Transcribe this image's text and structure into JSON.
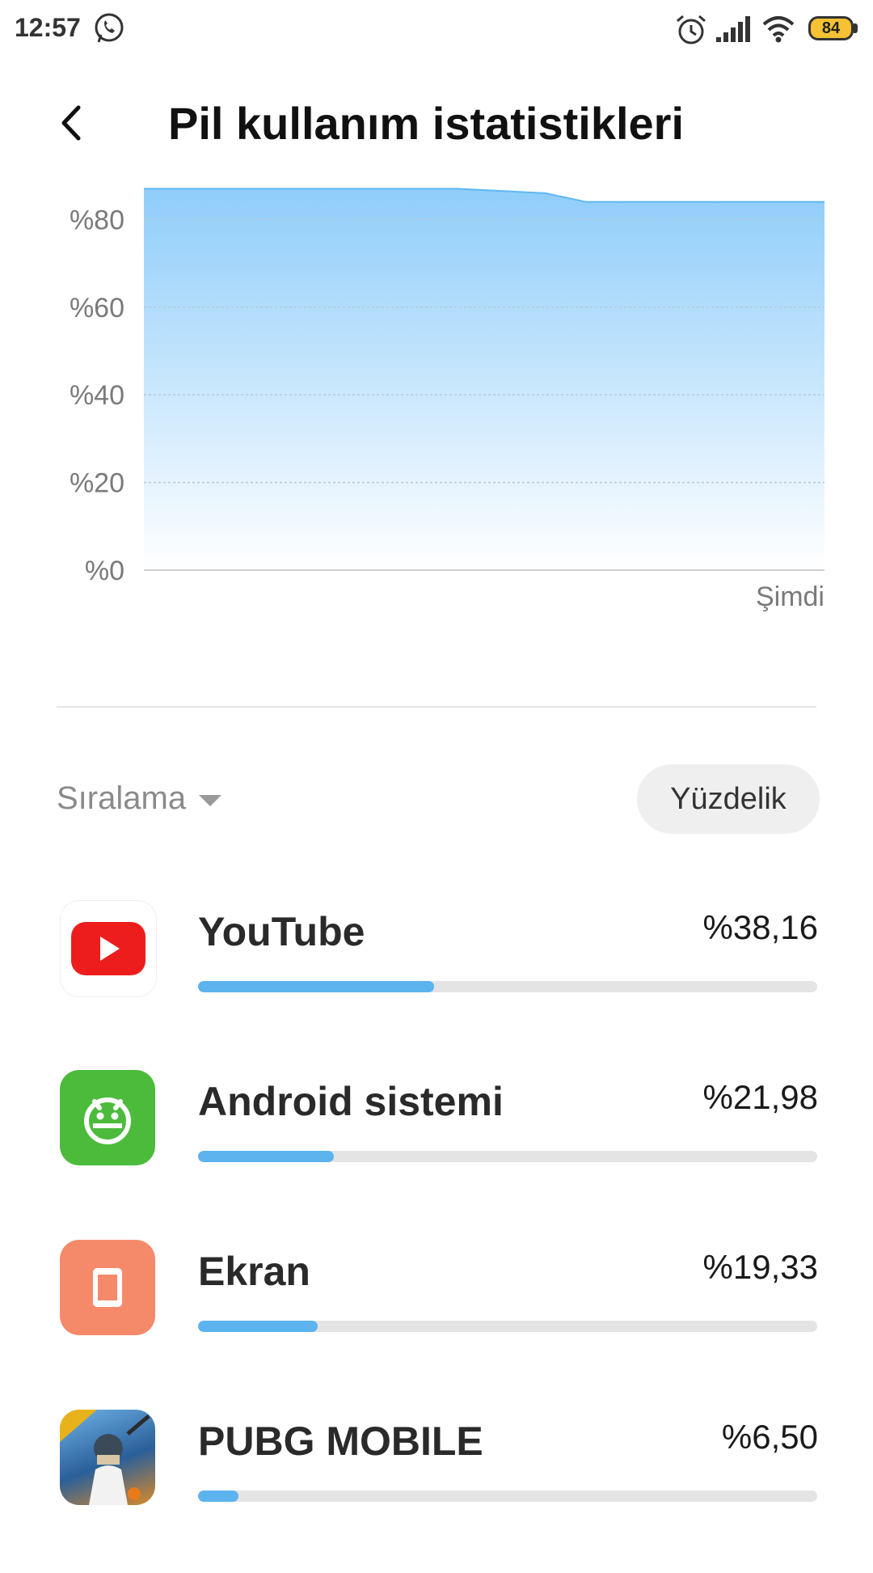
{
  "status_bar": {
    "time": "12:57",
    "battery_level": "84",
    "icons": [
      "whatsapp-icon",
      "alarm-icon",
      "signal-icon",
      "wifi-icon",
      "battery-icon"
    ]
  },
  "header": {
    "title": "Pil kullanım istatistikleri",
    "back_icon": "chevron-left-icon"
  },
  "chart_data": {
    "type": "area",
    "y_tick_labels": [
      "%80",
      "%60",
      "%40",
      "%20",
      "%0"
    ],
    "y_ticks": [
      80,
      60,
      40,
      20,
      0
    ],
    "ylim": [
      0,
      88
    ],
    "x_end_label": "Şimdi",
    "x": [
      0,
      0.46,
      0.59,
      0.65,
      1.0
    ],
    "values": [
      87,
      87,
      86,
      84,
      84
    ],
    "colors": {
      "line": "#5fb8f0",
      "fill_top": "#8fcdfa",
      "fill_bottom": "#ffffff"
    },
    "grid": true
  },
  "sort": {
    "label": "Sıralama",
    "mode_button": "Yüzdelik"
  },
  "apps": [
    {
      "name": "YouTube",
      "percent": "%38,16",
      "fraction": 0.3816,
      "icon": "youtube-icon"
    },
    {
      "name": "Android sistemi",
      "percent": "%21,98",
      "fraction": 0.2198,
      "icon": "android-icon"
    },
    {
      "name": "Ekran",
      "percent": "%19,33",
      "fraction": 0.1933,
      "icon": "screen-icon"
    },
    {
      "name": "PUBG MOBILE",
      "percent": "%6,50",
      "fraction": 0.065,
      "icon": "pubg-icon"
    }
  ],
  "colors": {
    "bar_fill": "#5db3ee",
    "bar_track": "#e4e4e4",
    "youtube_red": "#ee1d1d",
    "android_green": "#4cbb3c",
    "screen_orange": "#f58a6b"
  }
}
